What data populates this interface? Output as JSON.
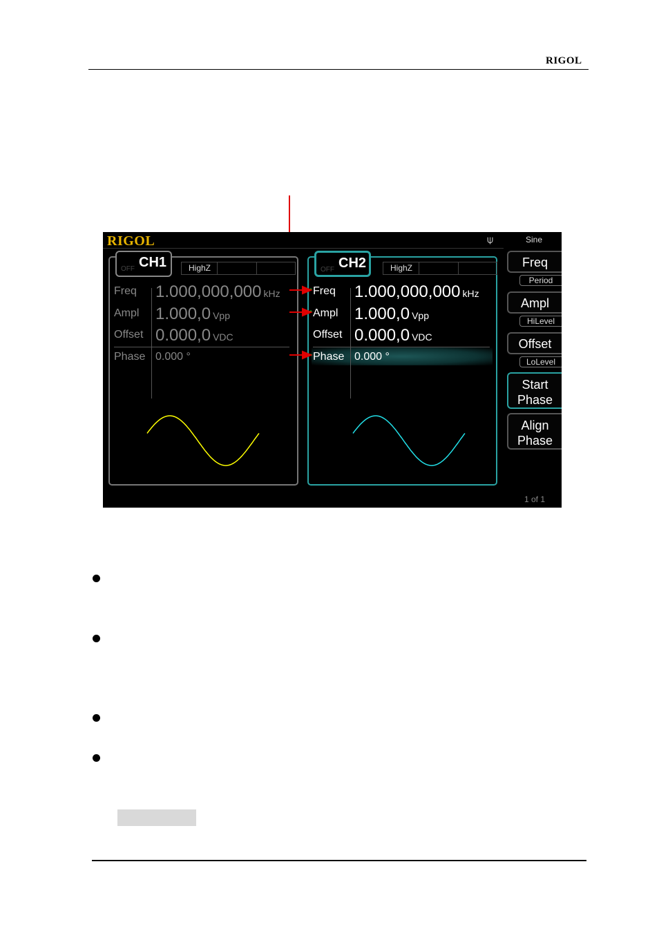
{
  "header": {
    "brand": "RIGOL"
  },
  "screen": {
    "logo": "RIGOL",
    "usb_icon": "usb-icon",
    "mode": "Sine",
    "channels": [
      {
        "name": "CH1",
        "state": "OFF",
        "load": "HighZ",
        "params": [
          {
            "label": "Freq",
            "value": "1.000,000,000",
            "unit": "kHz"
          },
          {
            "label": "Ampl",
            "value": "1.000,0",
            "unit": "Vpp"
          },
          {
            "label": "Offset",
            "value": "0.000,0",
            "unit": "VDC"
          },
          {
            "label": "Phase",
            "value": "0.000 °",
            "unit": ""
          }
        ],
        "wave_color": "#ffff00"
      },
      {
        "name": "CH2",
        "state": "OFF",
        "load": "HighZ",
        "params": [
          {
            "label": "Freq",
            "value": "1.000,000,000",
            "unit": "kHz",
            "marked": true
          },
          {
            "label": "Ampl",
            "value": "1.000,0",
            "unit": "Vpp",
            "marked": true
          },
          {
            "label": "Offset",
            "value": "0.000,0",
            "unit": "VDC",
            "marked": false
          },
          {
            "label": "Phase",
            "value": "0.000 °",
            "unit": "",
            "marked": true,
            "selected": true
          }
        ],
        "wave_color": "#22e0e8"
      }
    ],
    "softkeys": [
      {
        "label": "Freq",
        "sub": "Period"
      },
      {
        "label": "Ampl",
        "sub": "HiLevel"
      },
      {
        "label": "Offset",
        "sub": "LoLevel"
      },
      {
        "label": "Start Phase",
        "active": true
      },
      {
        "label": "Align Phase"
      }
    ],
    "page_indicator": "1 of 1"
  },
  "colors": {
    "callout": "#e00000",
    "ch2_accent": "#2aa3a3",
    "logo": "#e8b400"
  }
}
